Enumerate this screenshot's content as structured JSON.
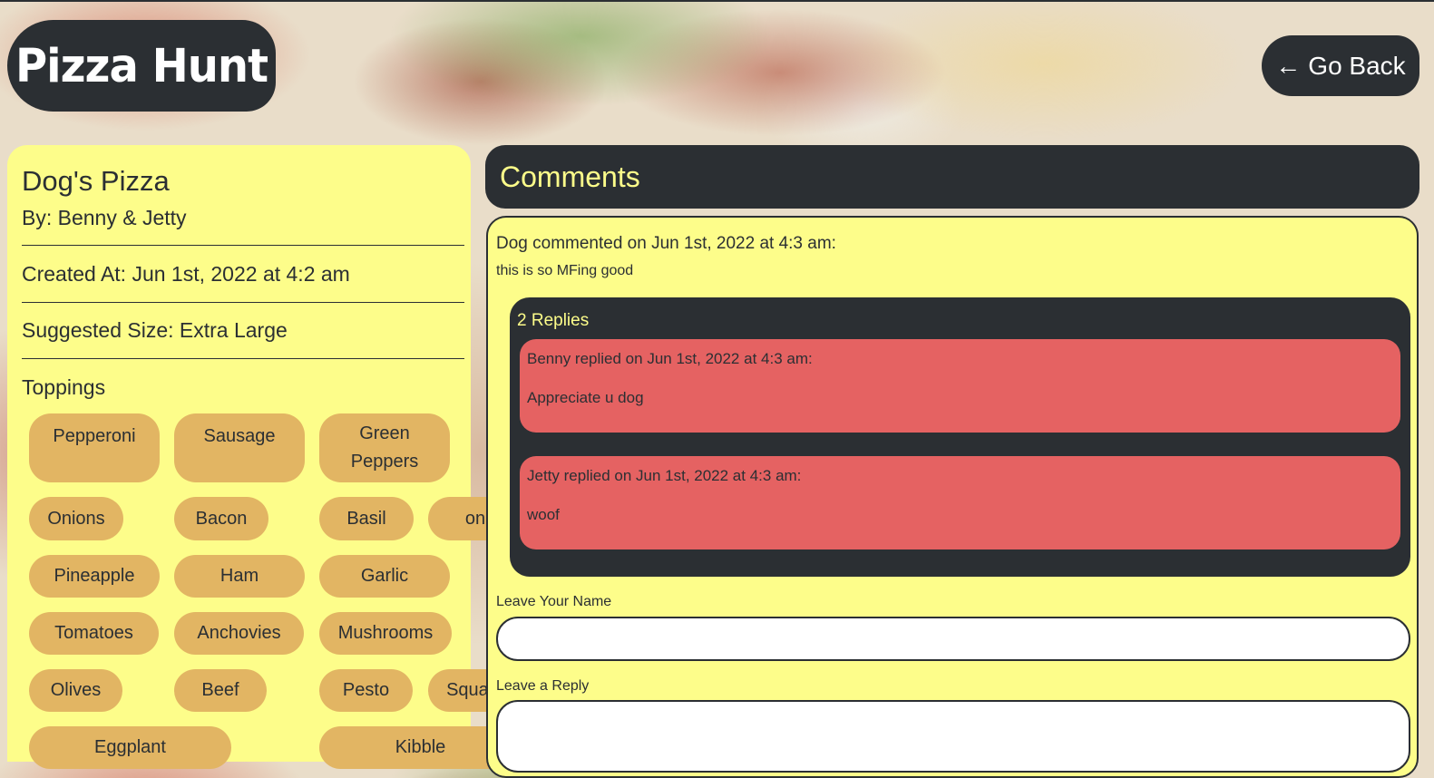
{
  "app": {
    "logo_text": "Pizza Hunt"
  },
  "nav": {
    "go_back_arrow": "←",
    "go_back_label": "Go Back"
  },
  "pizza": {
    "name": "Dog's Pizza",
    "by": "By: Benny & Jetty",
    "created_at": "Created At: Jun 1st, 2022 at 4:2 am",
    "suggested_size": "Suggested Size: Extra Large",
    "toppings_title": "Toppings",
    "toppings": [
      "Pepperoni",
      "Sausage",
      "Green Peppers",
      "Onions",
      "Bacon",
      "Basil",
      "on",
      "Pineapple",
      "Ham",
      "Garlic",
      "Tomatoes",
      "Anchovies",
      "Mushrooms",
      "Olives",
      "Beef",
      "Pesto",
      "Squash",
      "Eggplant",
      "Kibble"
    ]
  },
  "comments": {
    "title": "Comments",
    "items": [
      {
        "header": "Dog commented on Jun 1st, 2022 at 4:3 am:",
        "text": "this is so MFing good",
        "replies_title": "2 Replies",
        "replies": [
          {
            "header": "Benny replied on Jun 1st, 2022 at 4:3 am:",
            "text": "Appreciate u dog"
          },
          {
            "header": "Jetty replied on Jun 1st, 2022 at 4:3 am:",
            "text": "woof"
          }
        ]
      }
    ],
    "form": {
      "name_label": "Leave Your Name",
      "name_value": "",
      "reply_label": "Leave a Reply",
      "reply_value": ""
    }
  },
  "colors": {
    "dark": "#2b2f33",
    "yellow": "#fdfd8a",
    "chip": "#e2b563",
    "reply": "#e56262"
  }
}
